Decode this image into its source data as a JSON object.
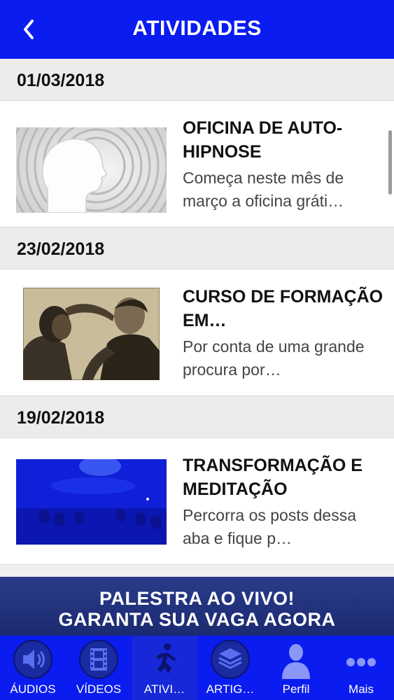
{
  "header": {
    "title": "ATIVIDADES",
    "back_icon": "chevron-left-icon"
  },
  "activities": [
    {
      "date": "01/03/2018",
      "title": "OFICINA DE AUTO-HIPNOSE",
      "description": "Começa neste mês de março a oficina gráti…",
      "image": "head-silhouette-spiral"
    },
    {
      "date": "23/02/2018",
      "title": "CURSO DE FORMAÇÃO EM…",
      "description": "Por conta de uma grande procura por…",
      "image": "hypnosis-vintage-photo"
    },
    {
      "date": "19/02/2018",
      "title": "TRANSFORMAÇÃO E MEDITAÇÃO",
      "description": "Percorra os posts dessa aba e fique p…",
      "image": "blue-meditation-room"
    }
  ],
  "banner": {
    "line1": "PALESTRA AO VIVO!",
    "line2": "GARANTA SUA VAGA AGORA"
  },
  "tabs": [
    {
      "label": "ÁUDIOS",
      "icon": "speaker-icon"
    },
    {
      "label": "VÍDEOS",
      "icon": "film-icon"
    },
    {
      "label": "ATIVI…",
      "icon": "running-person-icon"
    },
    {
      "label": "ARTIG…",
      "icon": "layers-icon"
    },
    {
      "label": "Perfil",
      "icon": "person-icon"
    },
    {
      "label": "Mais",
      "icon": "more-dots-icon"
    }
  ],
  "colors": {
    "primary": "#0a1cf0",
    "banner": "#1f2e78",
    "active_tab": "#1628d8"
  }
}
